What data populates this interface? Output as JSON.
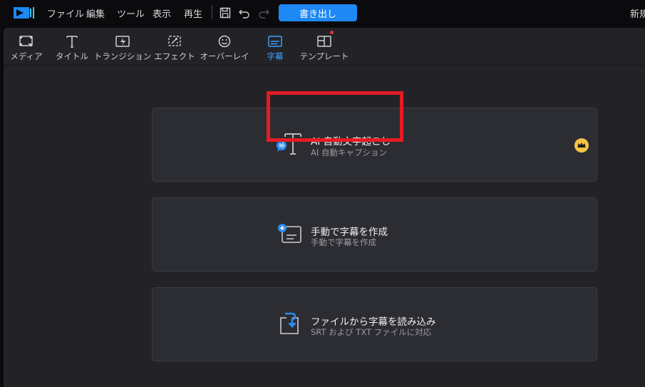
{
  "menubar": {
    "items": [
      "ファイル",
      "編集",
      "ツール",
      "表示",
      "再生"
    ],
    "export_label": "書き出し",
    "new_project_label": "新規"
  },
  "tabs": [
    {
      "label": "メディア",
      "icon": "media-icon"
    },
    {
      "label": "タイトル",
      "icon": "title-icon"
    },
    {
      "label": "トランジション",
      "icon": "transition-icon"
    },
    {
      "label": "エフェクト",
      "icon": "effect-icon"
    },
    {
      "label": "オーバーレイ",
      "icon": "overlay-icon"
    },
    {
      "label": "字幕",
      "icon": "subtitle-icon",
      "active": true
    },
    {
      "label": "テンプレート",
      "icon": "template-icon"
    }
  ],
  "cards": [
    {
      "title": "AI 自動文字起こし",
      "subtitle": "AI 自動キャプション",
      "icon": "ai-transcribe-icon",
      "premium": true
    },
    {
      "title": "手動で字幕を作成",
      "subtitle": "手動で字幕を作成",
      "icon": "manual-subtitle-icon"
    },
    {
      "title": "ファイルから字幕を読み込み",
      "subtitle": "SRT および TXT ファイルに対応",
      "icon": "import-file-icon"
    }
  ],
  "colors": {
    "accent": "#1e88f5",
    "active_tab": "#3aa0ff",
    "highlight": "#e51b24",
    "crown": "#f5c443"
  }
}
